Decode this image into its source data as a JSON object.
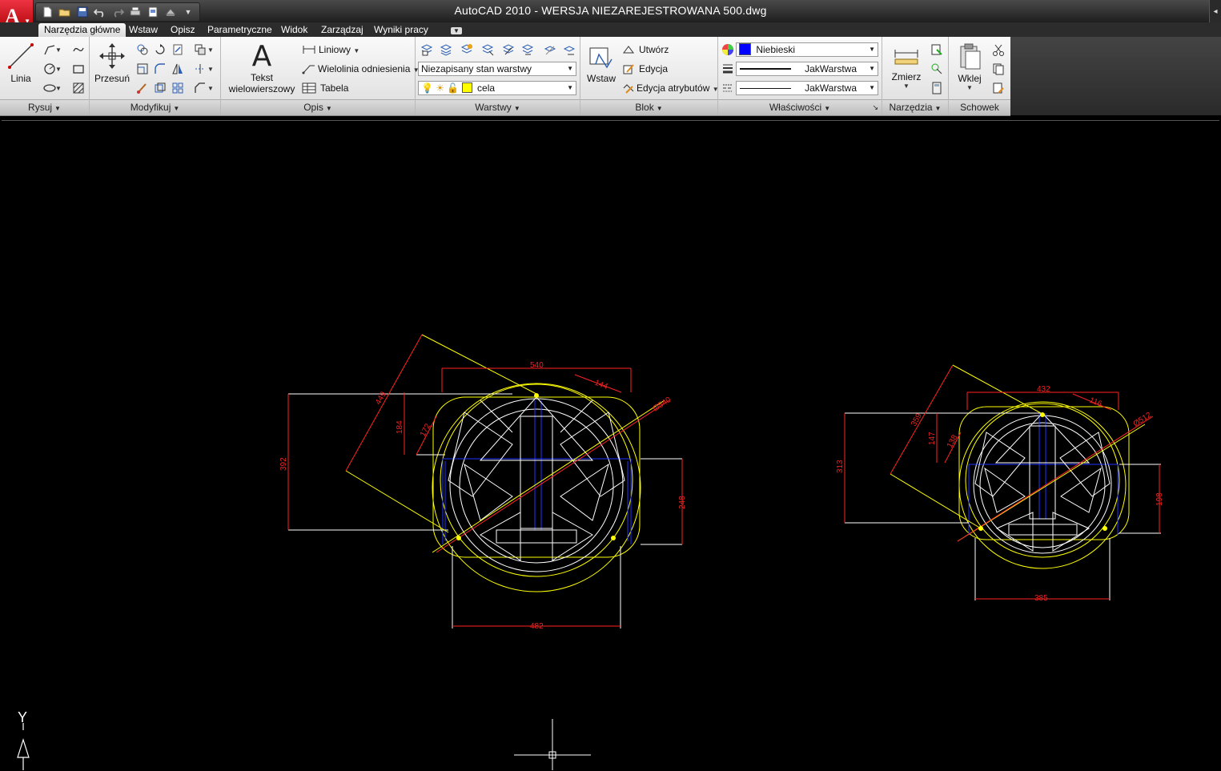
{
  "window": {
    "title": "AutoCAD 2010 - WERSJA NIEZAREJESTROWANA    500.dwg",
    "close_glyph": "◂"
  },
  "app_menu": {
    "logo_letter": "A"
  },
  "quick_access": {
    "icons": [
      "new-icon",
      "open-icon",
      "save-icon",
      "undo-icon",
      "redo-icon",
      "plot-icon",
      "preview-icon",
      "publish-icon",
      "customize-icon"
    ]
  },
  "tabs": [
    {
      "label": "Narzędzia główne",
      "active": true
    },
    {
      "label": "Wstaw"
    },
    {
      "label": "Opisz"
    },
    {
      "label": "Parametryczne"
    },
    {
      "label": "Widok"
    },
    {
      "label": "Zarządzaj"
    },
    {
      "label": "Wyniki pracy"
    }
  ],
  "ribbon": {
    "rysuj": {
      "label": "Rysuj",
      "linia": "Linia"
    },
    "modyfikuj": {
      "label": "Modyfikuj",
      "przesun": "Przesuń"
    },
    "opis": {
      "label": "Opis",
      "tekst_line1": "Tekst",
      "tekst_line2": "wielowierszowy",
      "liniowy": "Liniowy",
      "wielolinia": "Wielolinia odniesienia",
      "tabela": "Tabela"
    },
    "warstwy": {
      "label": "Warstwy",
      "layer_state": "Niezapisany stan warstwy",
      "current_layer": "cela",
      "layer_color": "#ffff00"
    },
    "blok": {
      "label": "Blok",
      "wstaw": "Wstaw",
      "utworz": "Utwórz",
      "edycja": "Edycja",
      "edycja_atr": "Edycja atrybutów"
    },
    "wlasciwosci": {
      "label": "Właściwości",
      "color": "Niebieski",
      "color_hex": "#0000ff",
      "linetype": "JakWarstwa",
      "lineweight": "JakWarstwa"
    },
    "narzedzia": {
      "label": "Narzędzia",
      "zmierz": "Zmierz"
    },
    "schowek": {
      "label": "Schowek",
      "wklej": "Wklej"
    }
  },
  "drawing": {
    "left": {
      "dims": [
        "540",
        "144",
        "Ø540",
        "449",
        "184",
        "172",
        "392",
        "248",
        "482"
      ]
    },
    "right": {
      "dims": [
        "432",
        "116",
        "Ø512",
        "359",
        "147",
        "138",
        "313",
        "198",
        "385"
      ]
    },
    "ucs": {
      "y_label": "Y"
    }
  }
}
